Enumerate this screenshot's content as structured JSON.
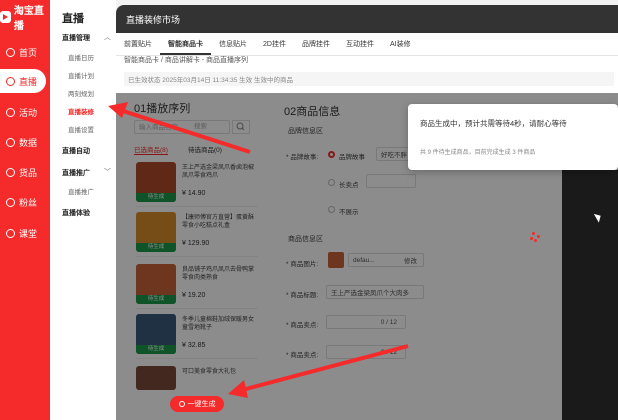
{
  "app": {
    "name": "淘宝直播"
  },
  "sidebar": {
    "items": [
      {
        "label": "首页",
        "icon": "home-icon"
      },
      {
        "label": "直播",
        "icon": "live-icon",
        "active": true
      },
      {
        "label": "活动",
        "icon": "activity-icon"
      },
      {
        "label": "数据",
        "icon": "data-icon"
      },
      {
        "label": "货品",
        "icon": "goods-icon"
      },
      {
        "label": "粉丝",
        "icon": "fans-icon"
      },
      {
        "label": "课堂",
        "icon": "classroom-icon"
      }
    ]
  },
  "subnav": {
    "title": "直播",
    "groups": [
      {
        "label": "直播管理",
        "items": [
          "直播日历",
          "直播计划",
          "两刻规划",
          "直播装修",
          "直播设置"
        ]
      },
      {
        "label": "直播自动",
        "items": []
      },
      {
        "label": "直播推广",
        "items": [
          "直播推广"
        ]
      },
      {
        "label": "直播体验",
        "items": []
      }
    ]
  },
  "modal": {
    "title": "直播装修市场",
    "tabs": [
      "前置贴片",
      "智能商品卡",
      "信息贴片",
      "2D挂件",
      "品牌挂件",
      "互动挂件",
      "AI装修"
    ],
    "breadcrumb": "智能商品卡 / 商品讲解卡 - 商品直播序列",
    "notice": "已生效状态 2025年03月14日 11:34:35 生效 生效中的商品"
  },
  "section1": {
    "title": "01播放序列",
    "search_placeholder": "输入商品名称",
    "search_btn": "搜索",
    "list_tabs": [
      "已选商品(8)",
      "待选商品(0)"
    ],
    "products": [
      {
        "title": "王上严选金梁凤爪香卤泡椒凤爪零食鸡爪",
        "price": "¥ 14.90",
        "tag": "待生成",
        "color": "#b04a2a"
      },
      {
        "title": "【康师傅官方直营】蛋黄酥零食小吃糕点礼盒",
        "price": "¥ 129.90",
        "tag": "待生成",
        "color": "#d88a2a"
      },
      {
        "title": "良品铺子鸡爪凤爪去骨鸭掌零食肉类熟食",
        "price": "¥ 19.20",
        "tag": "待生成",
        "color": "#c8623a"
      },
      {
        "title": "冬季儿童棉鞋加绒保暖男女童雪地靴子",
        "price": "¥ 32.85",
        "tag": "待生成",
        "color": "#3a5a7a"
      },
      {
        "title": "可口美食零食大礼包",
        "price": "",
        "tag": "",
        "color": "#7a4a3a"
      }
    ],
    "generate_btn": "一键生成"
  },
  "section2": {
    "title": "02商品信息",
    "product_info_label": "品牌信息区",
    "brand_story_label": "* 品牌故事:",
    "brand_story_opt1": "品牌故事",
    "brand_story_value": "好吃不胖",
    "brand_story_opt2": "长卖点",
    "brand_story_opt3": "不展示",
    "product_info_section": "商品信息区",
    "image_label": "* 商品图片:",
    "image_value": "defau...",
    "image_change": "修改",
    "name_label": "* 商品标题:",
    "name_value": "王上严选金梁凤爪个大肉多",
    "sell1_label": "* 商品卖点:",
    "sell1_value": "0 / 12",
    "sell2_label": "* 商品卖点:",
    "sell2_value": "0 / 12"
  },
  "toast": {
    "message": "商品生成中，预计共需等待4秒，请耐心等待",
    "sub": "共 9 件待生成商品，目前完成生成 3 件商品"
  },
  "colors": {
    "brand": "#f52a2a",
    "tag_green": "#1a9a4a",
    "header": "#333333"
  }
}
